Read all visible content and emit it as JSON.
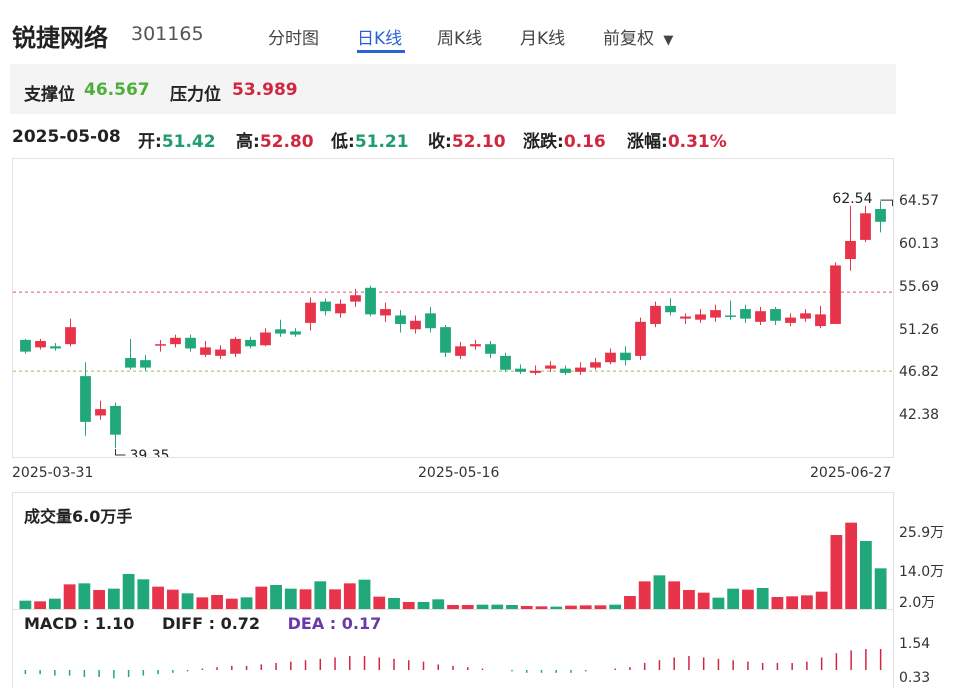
{
  "header": {
    "stock_name": "锐捷网络",
    "stock_code": "301165",
    "tabs": [
      "分时图",
      "日K线",
      "周K线",
      "月K线",
      "前复权"
    ],
    "active_tab": "日K线",
    "dropdown_glyph": "▼"
  },
  "levels": {
    "support_label": "支撑位",
    "support_value": "46.567",
    "pressure_label": "压力位",
    "pressure_value": "53.989"
  },
  "quote": {
    "date": "2025-05-08",
    "open_label": "开:",
    "open": "51.42",
    "high_label": "高:",
    "high": "52.80",
    "low_label": "低:",
    "low": "51.21",
    "close_label": "收:",
    "close": "52.10",
    "change_label": "涨跌:",
    "change": "0.16",
    "pct_label": "涨幅:",
    "pct": "0.31%"
  },
  "kline": {
    "y_ticks": [
      "64.57",
      "60.13",
      "55.69",
      "51.26",
      "46.82",
      "42.38"
    ],
    "x_dates": [
      "2025-03-31",
      "2025-05-16",
      "2025-06-27"
    ],
    "max_label": "62.54",
    "min_label": "39.35"
  },
  "volume": {
    "title": "成交量6.0万手",
    "y_ticks": [
      "25.9万",
      "14.0万",
      "2.0万"
    ]
  },
  "macd": {
    "macd_label": "MACD",
    "macd_value": "1.10",
    "diff_label": "DIFF",
    "diff_value": "0.72",
    "dea_label": "DEA",
    "dea_value": "0.17",
    "y_ticks": [
      "1.54",
      "0.33"
    ]
  },
  "chart_data": {
    "type": "candlestick",
    "y_range": [
      38.5,
      66.5
    ],
    "support": 46.567,
    "pressure": 53.989,
    "candles": [
      [
        49.5,
        48.4,
        49.6,
        48.2
      ],
      [
        48.8,
        49.4,
        49.6,
        48.6
      ],
      [
        48.9,
        48.7,
        49.2,
        48.5
      ],
      [
        49.1,
        50.7,
        51.5,
        48.9
      ],
      [
        46.1,
        41.8,
        47.4,
        40.5
      ],
      [
        42.4,
        43.0,
        43.8,
        42.0
      ],
      [
        43.3,
        40.6,
        43.6,
        39.35
      ],
      [
        47.8,
        46.9,
        49.6,
        46.7
      ],
      [
        47.6,
        46.9,
        48.1,
        46.6
      ],
      [
        49.0,
        49.1,
        49.5,
        48.4
      ],
      [
        49.1,
        49.7,
        50.0,
        48.8
      ],
      [
        49.7,
        48.7,
        50.0,
        48.4
      ],
      [
        48.1,
        48.8,
        49.4,
        47.9
      ],
      [
        48.0,
        48.6,
        49.0,
        47.7
      ],
      [
        48.2,
        49.6,
        49.8,
        47.9
      ],
      [
        49.5,
        48.9,
        49.8,
        48.7
      ],
      [
        49.0,
        50.2,
        50.6,
        48.9
      ],
      [
        50.5,
        50.1,
        51.4,
        49.8
      ],
      [
        50.3,
        50.0,
        50.6,
        49.8
      ],
      [
        51.1,
        53.0,
        53.5,
        50.4
      ],
      [
        53.1,
        52.2,
        53.4,
        51.8
      ],
      [
        52.0,
        52.9,
        53.3,
        51.6
      ],
      [
        53.1,
        53.7,
        54.3,
        52.6
      ],
      [
        54.4,
        51.9,
        54.6,
        51.7
      ],
      [
        51.8,
        52.4,
        53.0,
        51.2
      ],
      [
        51.8,
        51.0,
        52.3,
        50.2
      ],
      [
        50.5,
        51.3,
        51.8,
        50.1
      ],
      [
        52.0,
        50.6,
        52.6,
        50.2
      ],
      [
        50.7,
        48.3,
        50.9,
        47.9
      ],
      [
        48.0,
        48.9,
        49.3,
        47.7
      ],
      [
        48.9,
        49.1,
        49.5,
        48.6
      ],
      [
        49.1,
        48.2,
        49.4,
        47.8
      ],
      [
        48.0,
        46.7,
        48.3,
        46.5
      ],
      [
        46.8,
        46.5,
        47.2,
        46.3
      ],
      [
        46.4,
        46.6,
        47.1,
        46.2
      ],
      [
        46.8,
        47.1,
        47.5,
        46.5
      ],
      [
        46.8,
        46.4,
        47.1,
        46.2
      ],
      [
        46.5,
        46.9,
        47.4,
        46.2
      ],
      [
        46.9,
        47.4,
        47.8,
        46.7
      ],
      [
        47.4,
        48.3,
        48.7,
        47.2
      ],
      [
        48.3,
        47.6,
        48.9,
        47.1
      ],
      [
        48.0,
        51.2,
        51.6,
        47.6
      ],
      [
        51.0,
        52.7,
        53.1,
        50.7
      ],
      [
        52.7,
        52.1,
        53.4,
        51.8
      ],
      [
        51.5,
        51.7,
        52.0,
        51.0
      ],
      [
        51.4,
        51.9,
        52.4,
        51.1
      ],
      [
        51.6,
        52.3,
        52.8,
        51.2
      ],
      [
        51.8,
        51.7,
        53.2,
        51.4
      ],
      [
        52.4,
        51.5,
        52.8,
        51.1
      ],
      [
        51.2,
        52.2,
        52.6,
        50.9
      ],
      [
        52.4,
        51.3,
        52.6,
        50.9
      ],
      [
        51.1,
        51.6,
        52.0,
        50.8
      ],
      [
        51.5,
        52.0,
        52.4,
        51.2
      ],
      [
        50.8,
        51.9,
        52.7,
        50.6
      ],
      [
        51.0,
        56.5,
        56.8,
        51.0
      ],
      [
        57.1,
        58.8,
        62.1,
        56.0
      ],
      [
        58.9,
        61.4,
        62.1,
        58.7
      ],
      [
        61.8,
        60.6,
        62.54,
        59.6
      ]
    ],
    "volume_wan": [
      2.5,
      2.3,
      3.1,
      7.4,
      7.7,
      5.7,
      6.1,
      10.5,
      8.9,
      6.7,
      5.8,
      4.7,
      3.5,
      4.2,
      3.1,
      3.5,
      6.7,
      7.2,
      6.1,
      5.9,
      8.3,
      5.9,
      7.7,
      8.8,
      3.7,
      3.3,
      2.1,
      2.1,
      2.9,
      1.2,
      1.2,
      1.3,
      1.3,
      1.2,
      0.9,
      0.8,
      0.7,
      1.0,
      1.1,
      1.1,
      1.3,
      3.9,
      8.3,
      10.1,
      8.3,
      5.7,
      4.9,
      3.4,
      6.1,
      5.8,
      6.3,
      3.6,
      3.8,
      4.1,
      5.2,
      22.2,
      25.9,
      20.4,
      12.2
    ],
    "macd_hist": [
      -0.3,
      -0.3,
      -0.4,
      -0.4,
      -0.5,
      -0.5,
      -0.6,
      -0.5,
      -0.4,
      -0.3,
      -0.2,
      -0.1,
      0.1,
      0.2,
      0.3,
      0.3,
      0.4,
      0.5,
      0.6,
      0.7,
      0.8,
      0.9,
      1.0,
      1.0,
      0.9,
      0.8,
      0.7,
      0.6,
      0.4,
      0.3,
      0.2,
      0.1,
      0.0,
      -0.1,
      -0.2,
      -0.2,
      -0.2,
      -0.2,
      -0.1,
      0.0,
      0.1,
      0.2,
      0.5,
      0.7,
      0.9,
      1.0,
      0.9,
      0.8,
      0.7,
      0.6,
      0.5,
      0.5,
      0.5,
      0.6,
      0.9,
      1.2,
      1.4,
      1.5,
      1.5
    ]
  }
}
